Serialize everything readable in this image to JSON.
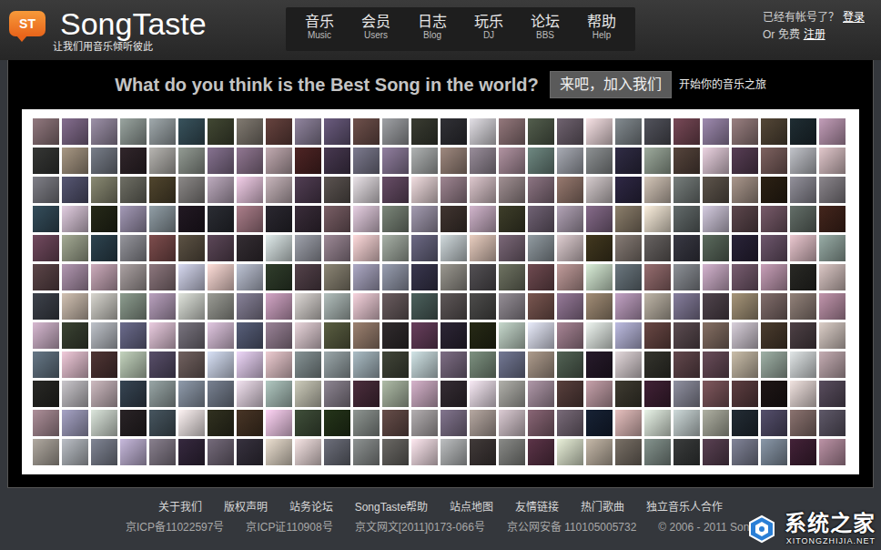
{
  "logo": {
    "badge": "ST",
    "name": "SongTaste",
    "slogan": "让我们用音乐倾听彼此"
  },
  "nav": [
    {
      "label": "音乐",
      "sub": "Music"
    },
    {
      "label": "会员",
      "sub": "Users"
    },
    {
      "label": "日志",
      "sub": "Blog"
    },
    {
      "label": "玩乐",
      "sub": "DJ"
    },
    {
      "label": "论坛",
      "sub": "BBS"
    },
    {
      "label": "帮助",
      "sub": "Help"
    }
  ],
  "account": {
    "prompt": "已经有帐号了？",
    "login": "登录",
    "or": "Or 免费",
    "register": "注册"
  },
  "hero": {
    "question": "What do you think is the Best Song in the world?",
    "button": "来吧，加入我们",
    "tagline": "开始你的音乐之旅"
  },
  "footer": {
    "links": [
      "关于我们",
      "版权声明",
      "站务论坛",
      "SongTaste帮助",
      "站点地图",
      "友情链接",
      "热门歌曲",
      "独立音乐人合作"
    ],
    "licenses": [
      "京ICP备11022597号",
      "京ICP证110908号",
      "京文网文[2011]0173-066号",
      "京公网安备 110105005732"
    ],
    "copyright": "© 2006 - 2011 Song"
  },
  "watermark": {
    "name": "系统之家",
    "url": "XITONGZHIJIA.NET"
  }
}
